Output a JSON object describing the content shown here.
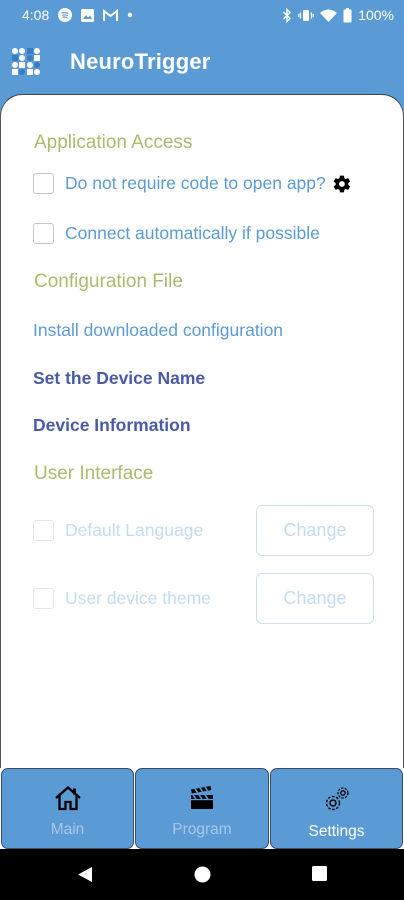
{
  "status_bar": {
    "time": "4:08",
    "battery": "100%",
    "icons": [
      "spotify-icon",
      "image-icon",
      "gmail-icon",
      "dot-icon",
      "bluetooth-icon",
      "vibrate-icon",
      "wifi-icon",
      "battery-icon"
    ]
  },
  "app_bar": {
    "title": "NeuroTrigger",
    "logo_icon": "neurotrigger-logo"
  },
  "settings": {
    "application_access": {
      "title": "Application Access",
      "no_code": {
        "label": "Do not require code to open app?",
        "checked": false,
        "icon": "gear-icon"
      },
      "auto_connect": {
        "label": "Connect automatically if possible",
        "checked": false
      }
    },
    "configuration_file": {
      "title": "Configuration File",
      "install": "Install downloaded configuration",
      "device_name": "Set the Device Name",
      "device_info": "Device Information"
    },
    "user_interface": {
      "title": "User Interface",
      "language": {
        "label": "Default Language",
        "checked": false,
        "enabled": false,
        "button": "Change"
      },
      "theme": {
        "label": "User device theme",
        "checked": false,
        "enabled": false,
        "button": "Change"
      }
    }
  },
  "tabs": [
    {
      "label": "Main",
      "icon": "home-icon",
      "active": false
    },
    {
      "label": "Program",
      "icon": "clapperboard-icon",
      "active": false
    },
    {
      "label": "Settings",
      "icon": "gears-icon",
      "active": true
    }
  ],
  "colors": {
    "primary": "#5b9bd5",
    "section": "#a7bc6c",
    "bold_link": "#4a5aa8",
    "disabled": "#c4dcf0"
  },
  "nav_bar": {
    "buttons": [
      "back-icon",
      "home-circle-icon",
      "recents-icon"
    ]
  }
}
